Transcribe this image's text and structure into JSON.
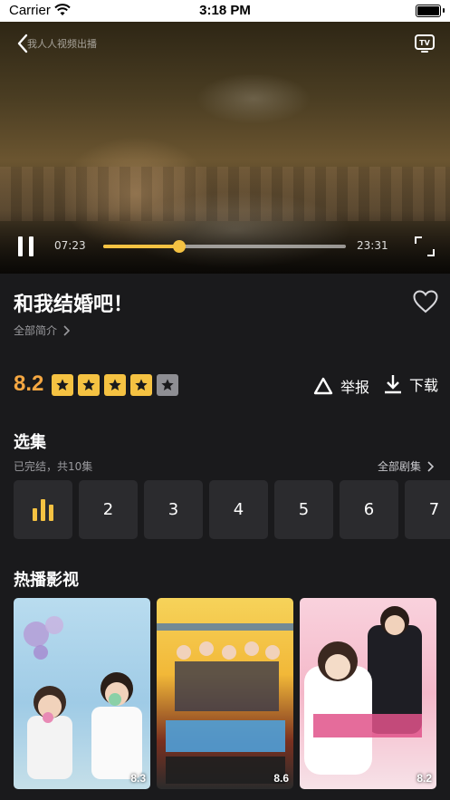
{
  "status_bar": {
    "carrier": "Carrier",
    "time": "3:18 PM"
  },
  "player": {
    "title": "我人人视频出播",
    "current_time": "07:23",
    "total_time": "23:31",
    "progress": 0.314
  },
  "show": {
    "title": "和我结婚吧！",
    "intro_link": "全部简介",
    "score": "8.2",
    "stars_filled": 4,
    "stars_total": 5,
    "report_label": "举报",
    "download_label": "下载"
  },
  "episodes_section": {
    "title": "选集",
    "status": "已完结，共10集",
    "all_label": "全部剧集",
    "episodes": [
      "1",
      "2",
      "3",
      "4",
      "5",
      "6",
      "7"
    ],
    "playing_index": 0
  },
  "hot_section": {
    "title": "热播影视",
    "items": [
      {
        "rating": "8.3"
      },
      {
        "rating": "8.6"
      },
      {
        "rating": "8.2"
      }
    ]
  },
  "colors": {
    "accent": "#f5c242",
    "score": "#f5a742",
    "background": "#1a1a1c",
    "card": "#2b2b2e"
  }
}
